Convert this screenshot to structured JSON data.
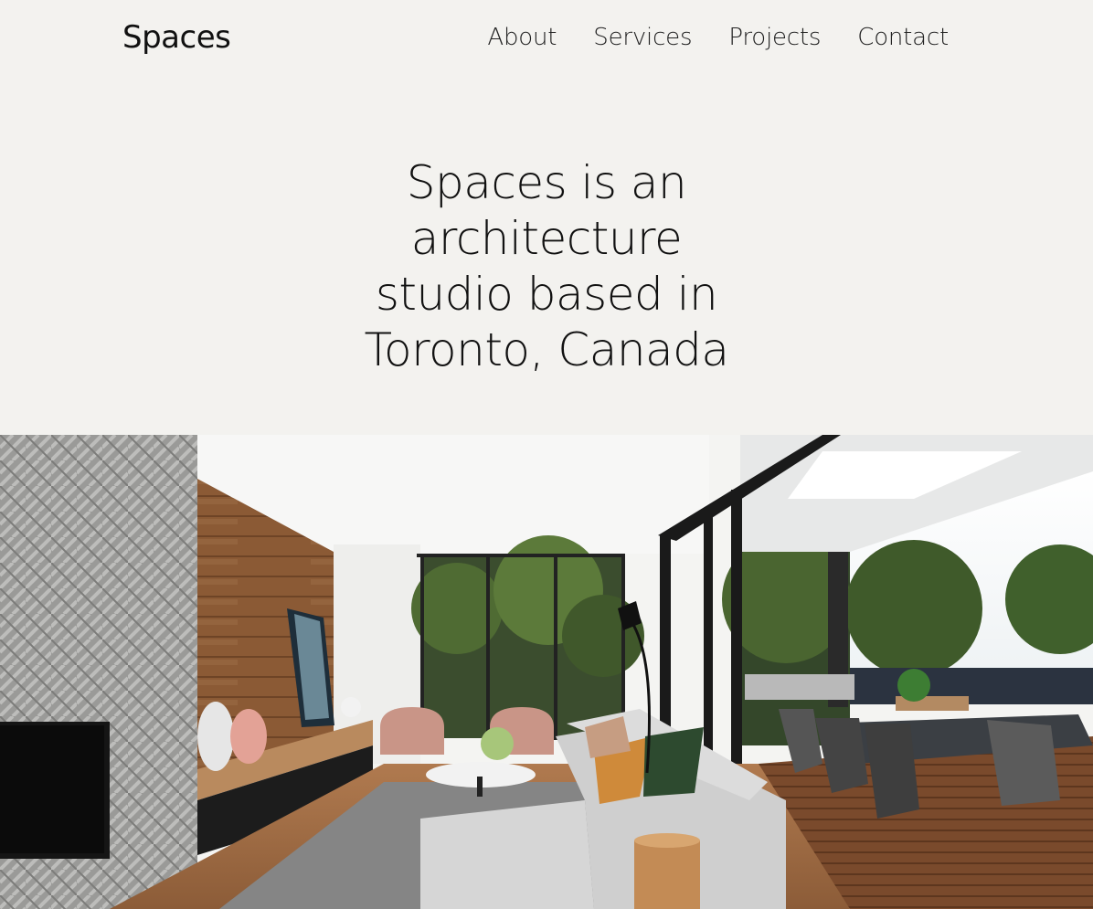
{
  "brand": {
    "name": "Spaces"
  },
  "nav": {
    "items": [
      {
        "label": "About"
      },
      {
        "label": "Services"
      },
      {
        "label": "Projects"
      },
      {
        "label": "Contact"
      }
    ]
  },
  "hero": {
    "lines": [
      "Spaces is an",
      "architecture",
      "studio based in",
      "Toronto, Canada"
    ]
  },
  "colors": {
    "background": "#f3f2ef",
    "text": "#111111"
  }
}
